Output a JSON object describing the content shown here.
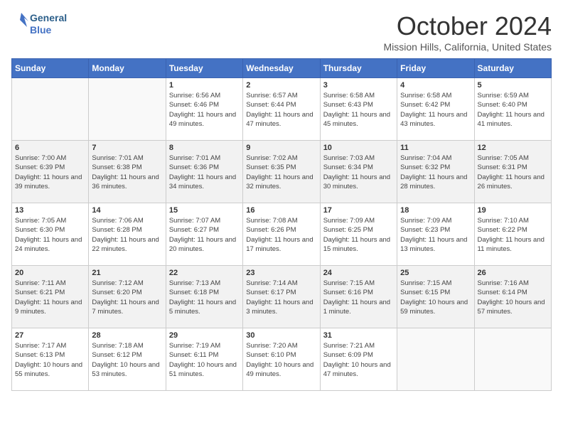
{
  "header": {
    "logo_line1": "General",
    "logo_line2": "Blue",
    "month": "October 2024",
    "location": "Mission Hills, California, United States"
  },
  "days_of_week": [
    "Sunday",
    "Monday",
    "Tuesday",
    "Wednesday",
    "Thursday",
    "Friday",
    "Saturday"
  ],
  "weeks": [
    [
      {
        "day": "",
        "info": ""
      },
      {
        "day": "",
        "info": ""
      },
      {
        "day": "1",
        "info": "Sunrise: 6:56 AM\nSunset: 6:46 PM\nDaylight: 11 hours and 49 minutes."
      },
      {
        "day": "2",
        "info": "Sunrise: 6:57 AM\nSunset: 6:44 PM\nDaylight: 11 hours and 47 minutes."
      },
      {
        "day": "3",
        "info": "Sunrise: 6:58 AM\nSunset: 6:43 PM\nDaylight: 11 hours and 45 minutes."
      },
      {
        "day": "4",
        "info": "Sunrise: 6:58 AM\nSunset: 6:42 PM\nDaylight: 11 hours and 43 minutes."
      },
      {
        "day": "5",
        "info": "Sunrise: 6:59 AM\nSunset: 6:40 PM\nDaylight: 11 hours and 41 minutes."
      }
    ],
    [
      {
        "day": "6",
        "info": "Sunrise: 7:00 AM\nSunset: 6:39 PM\nDaylight: 11 hours and 39 minutes."
      },
      {
        "day": "7",
        "info": "Sunrise: 7:01 AM\nSunset: 6:38 PM\nDaylight: 11 hours and 36 minutes."
      },
      {
        "day": "8",
        "info": "Sunrise: 7:01 AM\nSunset: 6:36 PM\nDaylight: 11 hours and 34 minutes."
      },
      {
        "day": "9",
        "info": "Sunrise: 7:02 AM\nSunset: 6:35 PM\nDaylight: 11 hours and 32 minutes."
      },
      {
        "day": "10",
        "info": "Sunrise: 7:03 AM\nSunset: 6:34 PM\nDaylight: 11 hours and 30 minutes."
      },
      {
        "day": "11",
        "info": "Sunrise: 7:04 AM\nSunset: 6:32 PM\nDaylight: 11 hours and 28 minutes."
      },
      {
        "day": "12",
        "info": "Sunrise: 7:05 AM\nSunset: 6:31 PM\nDaylight: 11 hours and 26 minutes."
      }
    ],
    [
      {
        "day": "13",
        "info": "Sunrise: 7:05 AM\nSunset: 6:30 PM\nDaylight: 11 hours and 24 minutes."
      },
      {
        "day": "14",
        "info": "Sunrise: 7:06 AM\nSunset: 6:28 PM\nDaylight: 11 hours and 22 minutes."
      },
      {
        "day": "15",
        "info": "Sunrise: 7:07 AM\nSunset: 6:27 PM\nDaylight: 11 hours and 20 minutes."
      },
      {
        "day": "16",
        "info": "Sunrise: 7:08 AM\nSunset: 6:26 PM\nDaylight: 11 hours and 17 minutes."
      },
      {
        "day": "17",
        "info": "Sunrise: 7:09 AM\nSunset: 6:25 PM\nDaylight: 11 hours and 15 minutes."
      },
      {
        "day": "18",
        "info": "Sunrise: 7:09 AM\nSunset: 6:23 PM\nDaylight: 11 hours and 13 minutes."
      },
      {
        "day": "19",
        "info": "Sunrise: 7:10 AM\nSunset: 6:22 PM\nDaylight: 11 hours and 11 minutes."
      }
    ],
    [
      {
        "day": "20",
        "info": "Sunrise: 7:11 AM\nSunset: 6:21 PM\nDaylight: 11 hours and 9 minutes."
      },
      {
        "day": "21",
        "info": "Sunrise: 7:12 AM\nSunset: 6:20 PM\nDaylight: 11 hours and 7 minutes."
      },
      {
        "day": "22",
        "info": "Sunrise: 7:13 AM\nSunset: 6:18 PM\nDaylight: 11 hours and 5 minutes."
      },
      {
        "day": "23",
        "info": "Sunrise: 7:14 AM\nSunset: 6:17 PM\nDaylight: 11 hours and 3 minutes."
      },
      {
        "day": "24",
        "info": "Sunrise: 7:15 AM\nSunset: 6:16 PM\nDaylight: 11 hours and 1 minute."
      },
      {
        "day": "25",
        "info": "Sunrise: 7:15 AM\nSunset: 6:15 PM\nDaylight: 10 hours and 59 minutes."
      },
      {
        "day": "26",
        "info": "Sunrise: 7:16 AM\nSunset: 6:14 PM\nDaylight: 10 hours and 57 minutes."
      }
    ],
    [
      {
        "day": "27",
        "info": "Sunrise: 7:17 AM\nSunset: 6:13 PM\nDaylight: 10 hours and 55 minutes."
      },
      {
        "day": "28",
        "info": "Sunrise: 7:18 AM\nSunset: 6:12 PM\nDaylight: 10 hours and 53 minutes."
      },
      {
        "day": "29",
        "info": "Sunrise: 7:19 AM\nSunset: 6:11 PM\nDaylight: 10 hours and 51 minutes."
      },
      {
        "day": "30",
        "info": "Sunrise: 7:20 AM\nSunset: 6:10 PM\nDaylight: 10 hours and 49 minutes."
      },
      {
        "day": "31",
        "info": "Sunrise: 7:21 AM\nSunset: 6:09 PM\nDaylight: 10 hours and 47 minutes."
      },
      {
        "day": "",
        "info": ""
      },
      {
        "day": "",
        "info": ""
      }
    ]
  ]
}
